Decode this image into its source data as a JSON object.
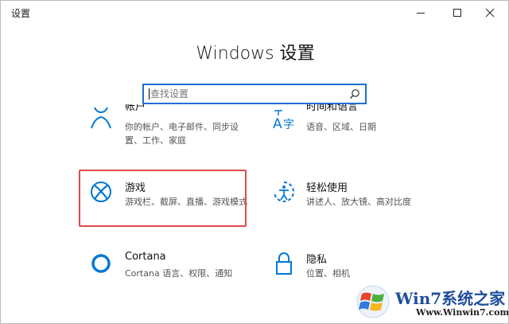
{
  "window": {
    "app_title": "设置",
    "buttons": {
      "minimize": "minimize-icon",
      "maximize": "maximize-icon",
      "close": "close-icon"
    }
  },
  "header": {
    "title": "Windows 设置"
  },
  "search": {
    "placeholder": "查找设置",
    "value": ""
  },
  "tiles": [
    {
      "id": "accounts",
      "title": "帐户",
      "desc_lines": [
        "你的帐户、电子邮件、同步设",
        "置、工作、家庭"
      ],
      "icon": "person-icon"
    },
    {
      "id": "time-language",
      "title": "时间和语言",
      "desc_lines": [
        "语音、区域、日期"
      ],
      "icon": "language-icon"
    },
    {
      "id": "gaming",
      "title": "游戏",
      "desc_lines": [
        "游戏栏、截屏、直播、游戏模式"
      ],
      "icon": "xbox-icon"
    },
    {
      "id": "ease-of-access",
      "title": "轻松使用",
      "desc_lines": [
        "讲述人、放大镜、高对比度"
      ],
      "icon": "ease-of-access-icon"
    },
    {
      "id": "cortana",
      "title": "Cortana",
      "desc_lines": [
        "Cortana 语言、权限、通知"
      ],
      "icon": "cortana-icon"
    },
    {
      "id": "privacy",
      "title": "隐私",
      "desc_lines": [
        "位置、相机"
      ],
      "icon": "lock-icon"
    }
  ],
  "watermark": {
    "brand": "Win7系统之家",
    "url": "Www.Winwin7.com"
  },
  "colors": {
    "accent": "#0078d7",
    "search_border": "#1c6fd6",
    "highlight": "#e04a4a"
  }
}
